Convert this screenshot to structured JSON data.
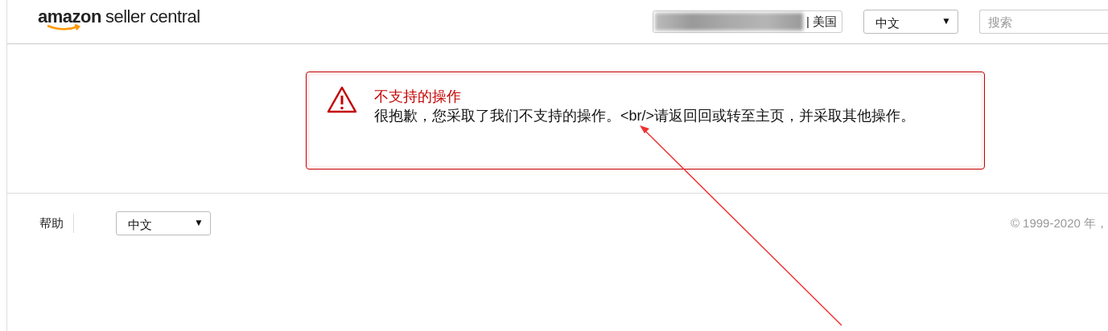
{
  "header": {
    "logo": {
      "brand": "amazon",
      "product": "seller central"
    },
    "account": {
      "region": "| 美国"
    },
    "language_select": {
      "value": "中文",
      "caret": "▼"
    },
    "search": {
      "placeholder": "搜索"
    }
  },
  "alert": {
    "title": "不支持的操作",
    "message": "很抱歉，您采取了我们不支持的操作。<br/>请返回回或转至主页，并采取其他操作。"
  },
  "footer": {
    "help_link": "帮助",
    "language_select": {
      "value": "中文",
      "caret": "▼"
    },
    "copyright": "© 1999-2020 年，"
  }
}
